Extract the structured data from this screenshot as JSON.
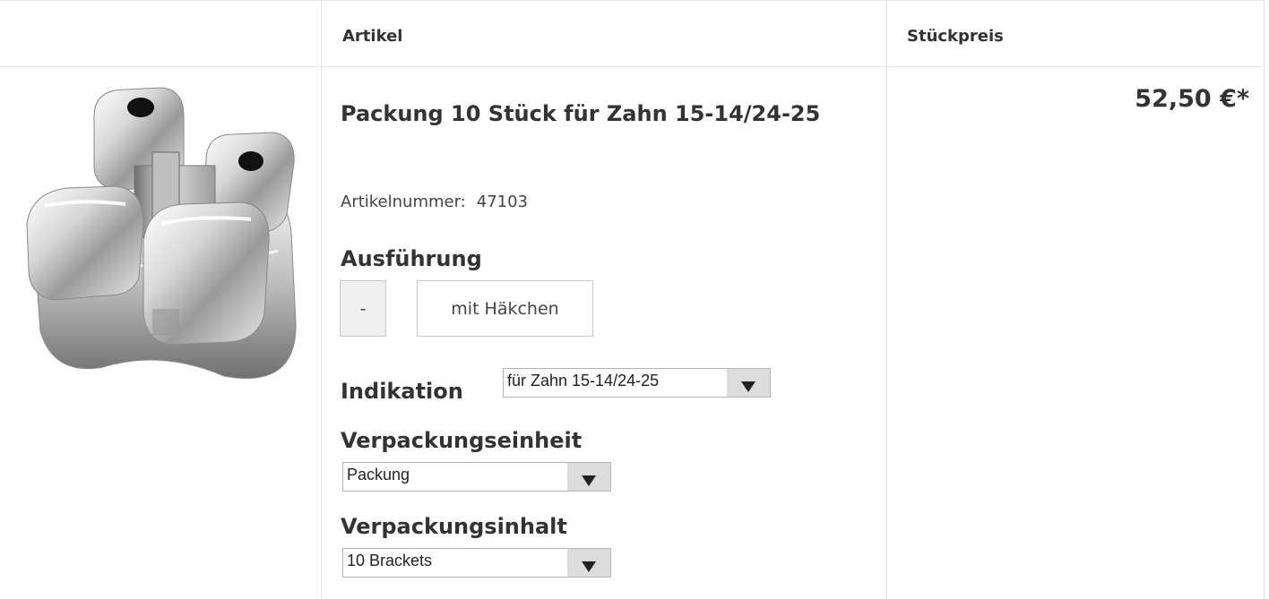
{
  "header": {
    "article_label": "Artikel",
    "unit_price_label": "Stückpreis"
  },
  "product": {
    "image_icon": "orthodontic-bracket-image",
    "title": "Packung 10 Stück für Zahn 15-14/24-25",
    "article_number_label": "Artikelnummer:",
    "article_number": "47103",
    "price": "52,50 €*"
  },
  "ausfuehrung": {
    "label": "Ausführung",
    "options": [
      "-",
      "mit Häkchen"
    ]
  },
  "indikation": {
    "label": "Indikation",
    "selected": "für Zahn 15-14/24-25"
  },
  "verpackungseinheit": {
    "label": "Verpackungseinheit",
    "selected": "Packung"
  },
  "verpackungsinhalt": {
    "label": "Verpackungsinhalt",
    "selected": "10 Brackets"
  },
  "colors": {
    "border": "#e6e6e6",
    "text": "#333333",
    "select_arrow_bg": "#dcdcdc"
  }
}
